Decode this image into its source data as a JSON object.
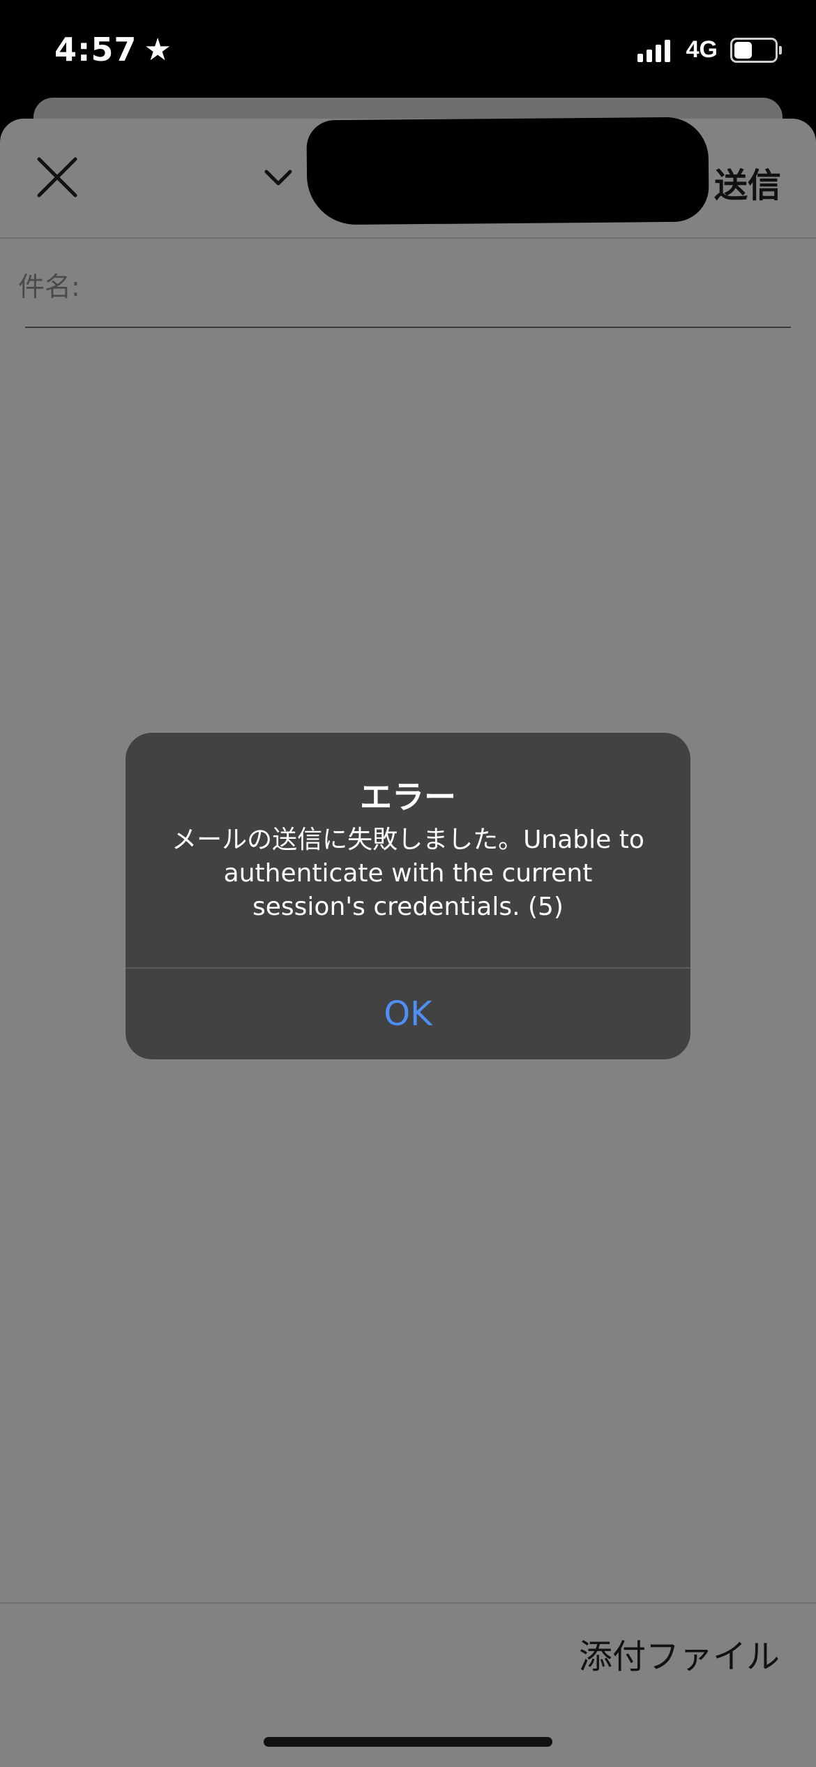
{
  "status_bar": {
    "time": "4:57",
    "network": "4G",
    "battery_level": 0.5
  },
  "compose": {
    "send_label": "送信",
    "subject_label": "件名:",
    "attach_label": "添付ファイル"
  },
  "dialog": {
    "title": "エラー",
    "message": "メールの送信に失敗しました。Unable to authenticate with the current session's credentials. (5)",
    "ok_label": "OK"
  },
  "colors": {
    "accent": "#4f8ef5",
    "dialog_bg": "#424242",
    "dimmed_bg": "#828282"
  }
}
